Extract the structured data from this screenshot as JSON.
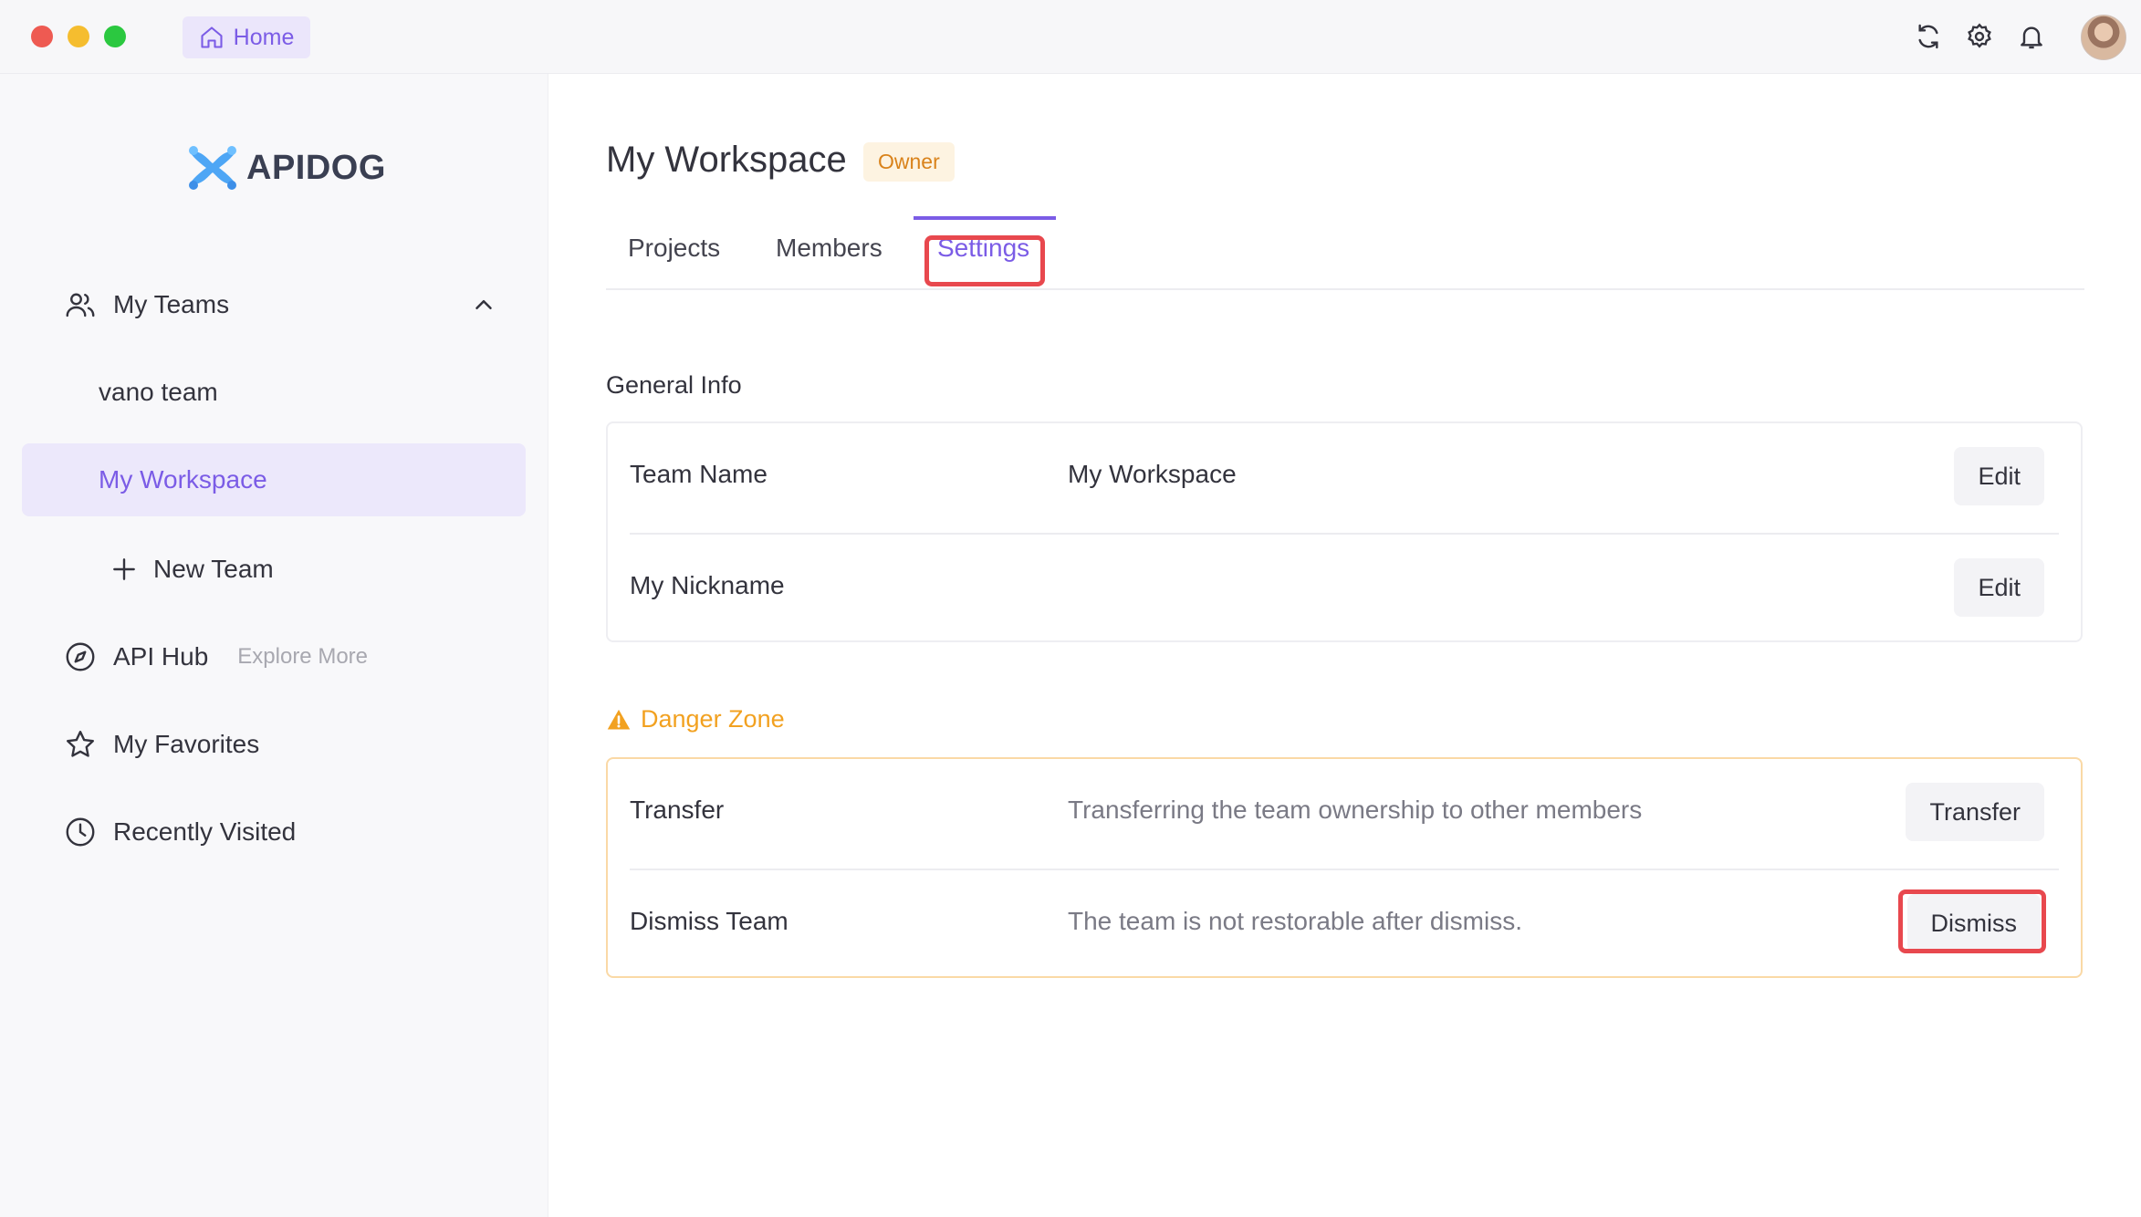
{
  "titlebar": {
    "home_tab": "Home",
    "icons": [
      "sync-icon",
      "gear-icon",
      "bell-icon",
      "avatar"
    ]
  },
  "sidebar": {
    "logo_text": "APIDOG",
    "my_teams": "My Teams",
    "teams": [
      "vano team",
      "My Workspace"
    ],
    "new_team": "New Team",
    "api_hub": "API Hub",
    "explore_more": "Explore More",
    "my_favorites": "My Favorites",
    "recently_visited": "Recently Visited"
  },
  "main": {
    "title": "My Workspace",
    "badge": "Owner",
    "tabs": [
      "Projects",
      "Members",
      "Settings"
    ],
    "active_tab": "Settings",
    "general": {
      "title": "General Info",
      "rows": [
        {
          "label": "Team Name",
          "value": "My Workspace",
          "button": "Edit"
        },
        {
          "label": "My Nickname",
          "value": "",
          "button": "Edit"
        }
      ]
    },
    "danger": {
      "title": "Danger Zone",
      "rows": [
        {
          "label": "Transfer",
          "desc": "Transferring the team ownership to other members",
          "button": "Transfer"
        },
        {
          "label": "Dismiss Team",
          "desc": "The team is not restorable after dismiss.",
          "button": "Dismiss"
        }
      ]
    }
  },
  "colors": {
    "accent": "#7b5ce6",
    "danger": "#f2a120",
    "highlight": "#e8484e"
  }
}
